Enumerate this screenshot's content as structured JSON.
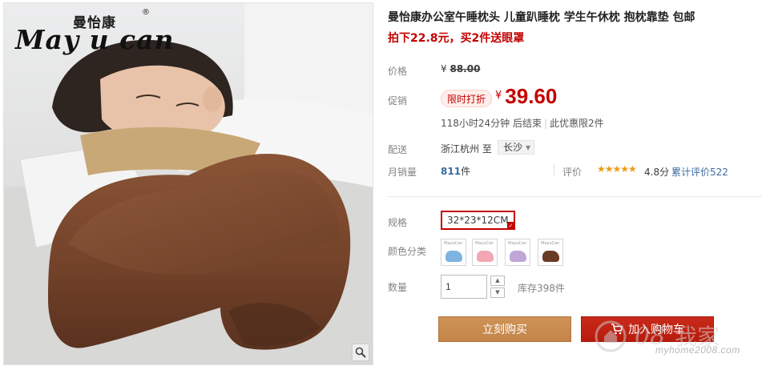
{
  "product_image": {
    "logo_cn": "曼怡康",
    "logo_reg": "®",
    "logo_en": "May u can",
    "zoom_icon": "magnifier-icon"
  },
  "product": {
    "title": "曼怡康办公室午睡枕头 儿童趴睡枕 学生午休枕 抱枕靠垫 包邮",
    "subtitle": "拍下22.8元，买2件送眼罩"
  },
  "price": {
    "label": "价格",
    "currency": "¥",
    "original": "88.00"
  },
  "promo": {
    "label": "促销",
    "badge": "限时打折",
    "currency": "¥",
    "price": "39.60",
    "countdown": "118小时24分钟 后结束",
    "limit": "此优惠限2件"
  },
  "shipping": {
    "label": "配送",
    "from": "浙江杭州",
    "to_word": "至",
    "destination": "长沙"
  },
  "sales": {
    "label": "月销量",
    "count": "811",
    "unit": "件",
    "rating_label": "评价",
    "stars": "★★★★★",
    "rating_value": 4.8,
    "score": "4.8分",
    "reviews_link": "累计评价522"
  },
  "options": {
    "size_label": "规格",
    "size_value": "32*23*12CM",
    "color_label": "颜色分类",
    "swatch_tag": "MayuCan",
    "swatches": [
      {
        "color": "#7fb4e0",
        "name": "blue"
      },
      {
        "color": "#f2a7b3",
        "name": "pink"
      },
      {
        "color": "#c0a6d6",
        "name": "purple"
      },
      {
        "color": "#6a3b24",
        "name": "brown"
      }
    ]
  },
  "quantity": {
    "label": "数量",
    "value": "1",
    "stock": "库存398件"
  },
  "actions": {
    "buy_now": "立刻购买",
    "add_cart": "加入购物车"
  },
  "watermark": {
    "url": "myhome2008.com"
  }
}
